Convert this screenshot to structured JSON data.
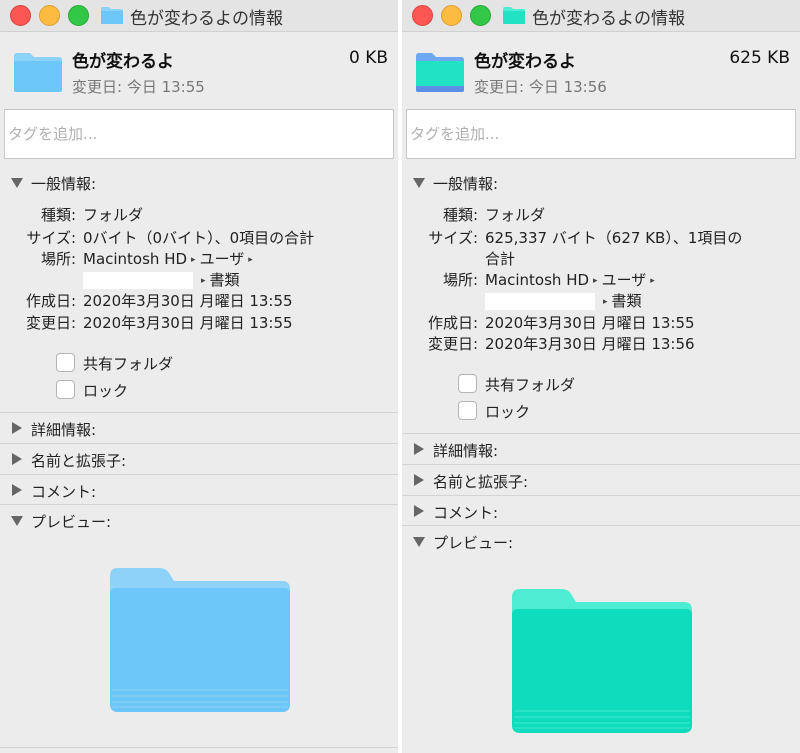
{
  "windows": [
    {
      "id": "left",
      "title": "色が変わるよの情報",
      "folder_color": "#6cc6f7",
      "file": {
        "name": "色が変わるよ",
        "size": "0 KB",
        "modified": "変更日: 今日 13:55"
      },
      "tags": {
        "placeholder": "タグを追加..."
      },
      "general": {
        "title": "一般情報:",
        "kind": {
          "label": "種類:",
          "value": "フォルダ"
        },
        "size": {
          "label": "サイズ:",
          "value": "0バイト（0バイト）、0項目の合計",
          "value2": ""
        },
        "location": {
          "label": "場所:",
          "drive": "Macintosh HD",
          "users": "ユーザ",
          "folder": "書類"
        },
        "created": {
          "label": "作成日:",
          "value": "2020年3月30日 月曜日 13:55"
        },
        "modified": {
          "label": "変更日:",
          "value": "2020年3月30日 月曜日 13:55"
        },
        "shared": {
          "label": "共有フォルダ",
          "checked": false
        },
        "locked": {
          "label": "ロック",
          "checked": false
        }
      },
      "sections": {
        "more": "詳細情報:",
        "name": "名前と拡張子:",
        "comments": "コメント:",
        "preview": "プレビュー:"
      }
    },
    {
      "id": "right",
      "title": "色が変わるよの情報",
      "folder_color": "#21e2c2",
      "file": {
        "name": "色が変わるよ",
        "size": "625 KB",
        "modified": "変更日: 今日 13:56"
      },
      "tags": {
        "placeholder": "タグを追加..."
      },
      "general": {
        "title": "一般情報:",
        "kind": {
          "label": "種類:",
          "value": "フォルダ"
        },
        "size": {
          "label": "サイズ:",
          "value": "625,337 バイト（627 KB）、1項目の",
          "value2": "合計"
        },
        "location": {
          "label": "場所:",
          "drive": "Macintosh HD",
          "users": "ユーザ",
          "folder": "書類"
        },
        "created": {
          "label": "作成日:",
          "value": "2020年3月30日 月曜日 13:55"
        },
        "modified": {
          "label": "変更日:",
          "value": "2020年3月30日 月曜日 13:56"
        },
        "shared": {
          "label": "共有フォルダ",
          "checked": false
        },
        "locked": {
          "label": "ロック",
          "checked": false
        }
      },
      "sections": {
        "more": "詳細情報:",
        "name": "名前と拡張子:",
        "comments": "コメント:",
        "preview": "プレビュー:"
      }
    }
  ]
}
